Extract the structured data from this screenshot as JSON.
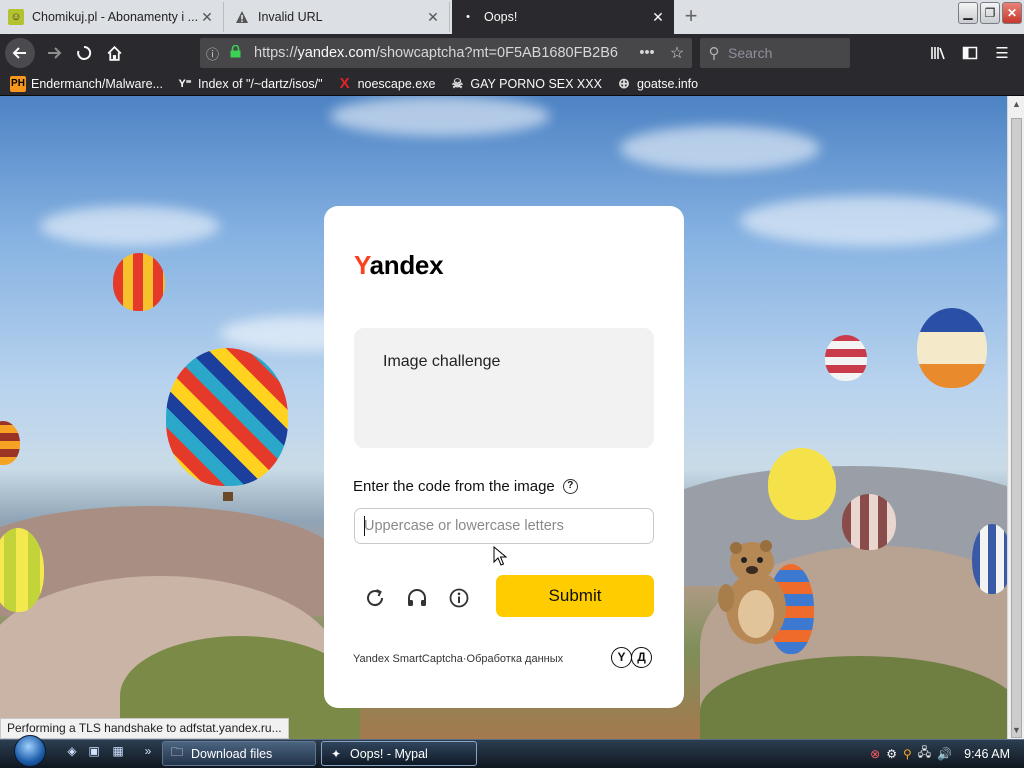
{
  "browser": {
    "tabs": [
      {
        "title": "Chomikuj.pl - Abonamenty i ...",
        "favicon": "chomikuj-icon"
      },
      {
        "title": "Invalid URL",
        "favicon": "warning-icon"
      },
      {
        "title": "Oops!",
        "favicon": "loading-dot-icon",
        "active": true
      }
    ],
    "new_tab": "+",
    "url_host": "yandex.com",
    "url_prefix": "https://",
    "url_path": "/showcaptcha?mt=0F5AB1680FB2B6",
    "search_placeholder": "Search",
    "bookmarks": [
      {
        "label": "Endermanch/Malware...",
        "icon": "PH"
      },
      {
        "label": "Index of \"/~dartz/isos/\"",
        "icon": "Y"
      },
      {
        "label": "noescape.exe",
        "icon": "X"
      },
      {
        "label": "GAY PORNO SEX XXX",
        "icon": "skull"
      },
      {
        "label": "goatse.info",
        "icon": "globe"
      }
    ],
    "status_text": "Performing a TLS handshake to adfstat.yandex.ru..."
  },
  "captcha": {
    "logo_first": "Y",
    "logo_rest": "andex",
    "challenge_label": "Image challenge",
    "prompt": "Enter the code from the image",
    "help_glyph": "?",
    "input_placeholder": "Uppercase or lowercase letters",
    "input_value": "",
    "submit_label": "Submit",
    "footer_text": "Yandex SmartCaptcha·Обработка данных",
    "badge_1": "Y",
    "badge_2": "Д"
  },
  "taskbar": {
    "tasks": [
      {
        "label": "Download files"
      },
      {
        "label": "Oops! - Mypal",
        "active": true
      }
    ],
    "clock": "9:46 AM"
  },
  "colors": {
    "yandex_red": "#fc3f1d",
    "submit_yellow": "#ffcc00",
    "browser_dark": "#2a2a2e"
  }
}
